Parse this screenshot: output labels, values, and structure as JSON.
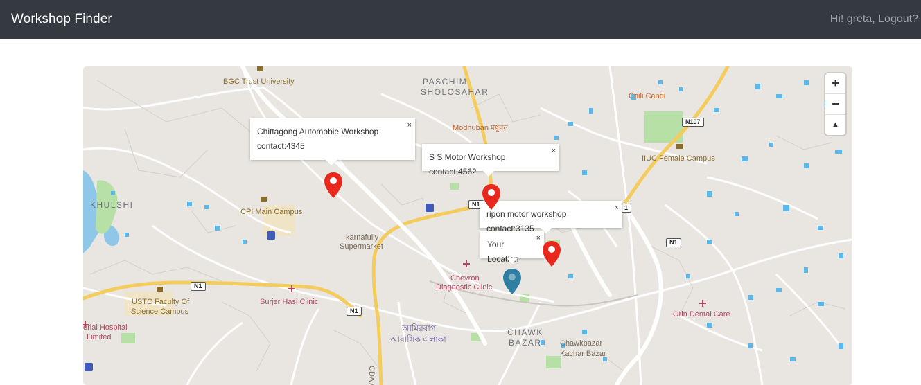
{
  "navbar": {
    "brand": "Workshop Finder",
    "user_text": "Hi! greta, Logout?"
  },
  "map": {
    "zoom_in": "+",
    "zoom_out": "−",
    "compass": "▲",
    "labels": {
      "bgc": "BGC Trust University",
      "paschim": "PASCHIM",
      "sholosahar": "SHOLOSAHAR",
      "modhuban": "Modhuban মধুবন",
      "chili": "Chili Candi",
      "iiuc": "IIUC Female Campus",
      "khulshi": "KHULSHI",
      "cpi": "CPI Main Campus",
      "karnafully1": "karnafully",
      "karnafully2": "Supermarket",
      "chevron1": "Chevron",
      "chevron2": "Diagnostic Clinic",
      "ustc1": "USTC Faculty Of",
      "ustc2": "Science Campus",
      "surjer": "Surjer Hasi Clinic",
      "imperial1": "erial Hospital",
      "imperial2": "Limited",
      "amirbag1": "আমিরবাগ",
      "amirbag2": "আবাসিক এলাকা",
      "chawk1": "CHAWK",
      "chawk2": "BAZAR",
      "chawkbazar1": "Chawkbazar",
      "chawkbazar2": "Kachar Bazar",
      "orin": "Orin Dental Care",
      "cda": "CDA A"
    },
    "shields": {
      "n107": "N107",
      "n1_a": "N1",
      "n1_b": "N1",
      "n1_c": "N1",
      "n1_d": "N1",
      "n1_e": "1"
    },
    "popups": {
      "chittagong_line1": "Chittagong Automobie Workshop",
      "chittagong_line2": "contact:4345",
      "ss_motor": "S S Motor Workshop contact:4562",
      "ripon": "ripon motor workshop contact:3135",
      "your_location": "Your Location",
      "close": "×"
    },
    "colors": {
      "workshop_marker": "#e8271d",
      "user_marker": "#2f7fa3",
      "water": "#5bb8e8",
      "park": "#b7e0a6",
      "major_road": "#f3cc5d"
    }
  }
}
